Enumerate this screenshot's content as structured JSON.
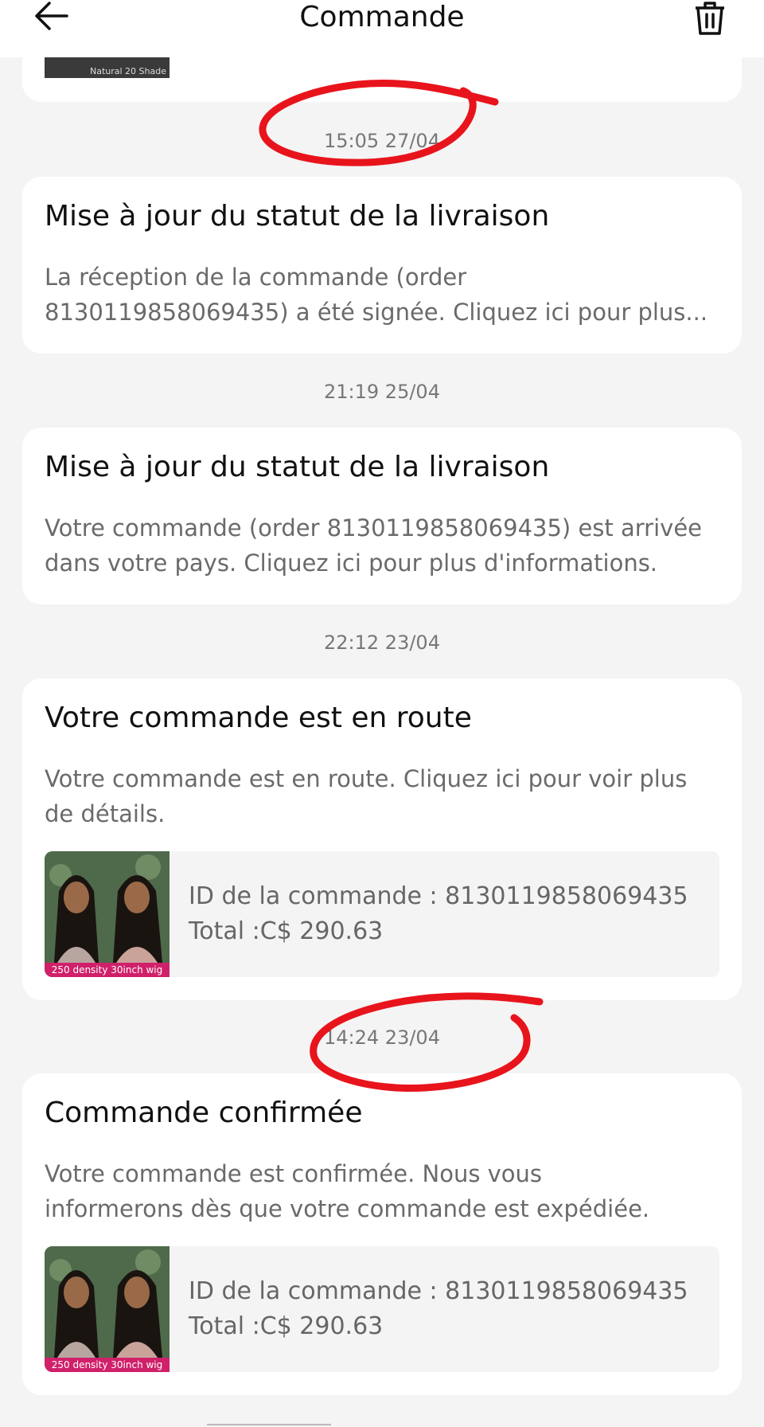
{
  "header": {
    "title": "Commande"
  },
  "top_card": {
    "thumb_caption": "Natural 20 Shade"
  },
  "messages": [
    {
      "timestamp": "15:05 27/04",
      "title": "Mise à jour du statut de la livraison",
      "body_line1": "La réception de la commande (order",
      "body_line2": "8130119858069435) a été signée. Cliquez ici pour plus..."
    },
    {
      "timestamp": "21:19 25/04",
      "title": "Mise à jour du statut de la livraison",
      "body_line1": "Votre commande (order 8130119858069435) est arrivée",
      "body_line2": "dans votre pays. Cliquez ici pour plus d'informations."
    },
    {
      "timestamp": "22:12 23/04",
      "title": "Votre commande est en route",
      "body_line1": "Votre commande est en route. Cliquez ici pour voir plus",
      "body_line2": "de détails.",
      "order": {
        "id_text": "ID de la commande : 8130119858069435",
        "total_text": "Total :C$ 290.63",
        "thumb_caption": "250 density 30inch wig"
      }
    },
    {
      "timestamp": "14:24 23/04",
      "title": "Commande confirmée",
      "body_line1": "Votre commande est confirmée. Nous vous",
      "body_line2": "informerons dès que votre commande est expédiée.",
      "order": {
        "id_text": "ID de la commande : 8130119858069435",
        "total_text": "Total :C$ 290.63",
        "thumb_caption": "250 density 30inch wig"
      }
    }
  ],
  "colors": {
    "background": "#f4f4f4",
    "card": "#ffffff",
    "annotation": "#e8141c",
    "thumb_band": "#d0206a"
  },
  "icons": [
    "back-arrow-icon",
    "trash-icon"
  ]
}
